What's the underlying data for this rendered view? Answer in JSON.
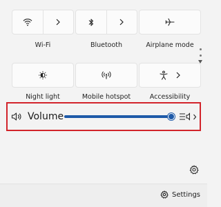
{
  "tiles": [
    {
      "id": "wifi",
      "label": "Wi-Fi",
      "icon": "wifi-icon"
    },
    {
      "id": "bluetooth",
      "label": "Bluetooth",
      "icon": "bluetooth-icon"
    },
    {
      "id": "airplane",
      "label": "Airplane mode",
      "icon": "airplane-icon"
    },
    {
      "id": "nightlight",
      "label": "Night light",
      "icon": "night-light-icon"
    },
    {
      "id": "hotspot",
      "label": "Mobile hotspot",
      "icon": "hotspot-icon"
    },
    {
      "id": "accessibility",
      "label": "Accessibility",
      "icon": "accessibility-icon"
    }
  ],
  "volume": {
    "label": "Volume",
    "level_fraction": 0.98,
    "accent_color": "#1e5aa8",
    "highlight_color": "#d2232a",
    "icon": "speaker-icon"
  },
  "footer": {
    "settings_label": "Settings"
  }
}
